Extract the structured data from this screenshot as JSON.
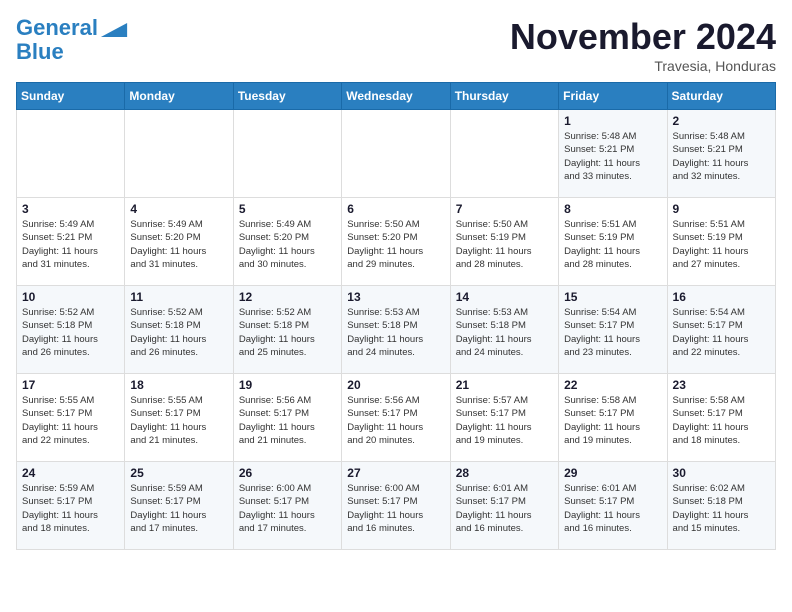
{
  "header": {
    "logo_line1": "General",
    "logo_line2": "Blue",
    "month": "November 2024",
    "location": "Travesia, Honduras"
  },
  "weekdays": [
    "Sunday",
    "Monday",
    "Tuesday",
    "Wednesday",
    "Thursday",
    "Friday",
    "Saturday"
  ],
  "weeks": [
    [
      {
        "day": "",
        "info": ""
      },
      {
        "day": "",
        "info": ""
      },
      {
        "day": "",
        "info": ""
      },
      {
        "day": "",
        "info": ""
      },
      {
        "day": "",
        "info": ""
      },
      {
        "day": "1",
        "info": "Sunrise: 5:48 AM\nSunset: 5:21 PM\nDaylight: 11 hours\nand 33 minutes."
      },
      {
        "day": "2",
        "info": "Sunrise: 5:48 AM\nSunset: 5:21 PM\nDaylight: 11 hours\nand 32 minutes."
      }
    ],
    [
      {
        "day": "3",
        "info": "Sunrise: 5:49 AM\nSunset: 5:21 PM\nDaylight: 11 hours\nand 31 minutes."
      },
      {
        "day": "4",
        "info": "Sunrise: 5:49 AM\nSunset: 5:20 PM\nDaylight: 11 hours\nand 31 minutes."
      },
      {
        "day": "5",
        "info": "Sunrise: 5:49 AM\nSunset: 5:20 PM\nDaylight: 11 hours\nand 30 minutes."
      },
      {
        "day": "6",
        "info": "Sunrise: 5:50 AM\nSunset: 5:20 PM\nDaylight: 11 hours\nand 29 minutes."
      },
      {
        "day": "7",
        "info": "Sunrise: 5:50 AM\nSunset: 5:19 PM\nDaylight: 11 hours\nand 28 minutes."
      },
      {
        "day": "8",
        "info": "Sunrise: 5:51 AM\nSunset: 5:19 PM\nDaylight: 11 hours\nand 28 minutes."
      },
      {
        "day": "9",
        "info": "Sunrise: 5:51 AM\nSunset: 5:19 PM\nDaylight: 11 hours\nand 27 minutes."
      }
    ],
    [
      {
        "day": "10",
        "info": "Sunrise: 5:52 AM\nSunset: 5:18 PM\nDaylight: 11 hours\nand 26 minutes."
      },
      {
        "day": "11",
        "info": "Sunrise: 5:52 AM\nSunset: 5:18 PM\nDaylight: 11 hours\nand 26 minutes."
      },
      {
        "day": "12",
        "info": "Sunrise: 5:52 AM\nSunset: 5:18 PM\nDaylight: 11 hours\nand 25 minutes."
      },
      {
        "day": "13",
        "info": "Sunrise: 5:53 AM\nSunset: 5:18 PM\nDaylight: 11 hours\nand 24 minutes."
      },
      {
        "day": "14",
        "info": "Sunrise: 5:53 AM\nSunset: 5:18 PM\nDaylight: 11 hours\nand 24 minutes."
      },
      {
        "day": "15",
        "info": "Sunrise: 5:54 AM\nSunset: 5:17 PM\nDaylight: 11 hours\nand 23 minutes."
      },
      {
        "day": "16",
        "info": "Sunrise: 5:54 AM\nSunset: 5:17 PM\nDaylight: 11 hours\nand 22 minutes."
      }
    ],
    [
      {
        "day": "17",
        "info": "Sunrise: 5:55 AM\nSunset: 5:17 PM\nDaylight: 11 hours\nand 22 minutes."
      },
      {
        "day": "18",
        "info": "Sunrise: 5:55 AM\nSunset: 5:17 PM\nDaylight: 11 hours\nand 21 minutes."
      },
      {
        "day": "19",
        "info": "Sunrise: 5:56 AM\nSunset: 5:17 PM\nDaylight: 11 hours\nand 21 minutes."
      },
      {
        "day": "20",
        "info": "Sunrise: 5:56 AM\nSunset: 5:17 PM\nDaylight: 11 hours\nand 20 minutes."
      },
      {
        "day": "21",
        "info": "Sunrise: 5:57 AM\nSunset: 5:17 PM\nDaylight: 11 hours\nand 19 minutes."
      },
      {
        "day": "22",
        "info": "Sunrise: 5:58 AM\nSunset: 5:17 PM\nDaylight: 11 hours\nand 19 minutes."
      },
      {
        "day": "23",
        "info": "Sunrise: 5:58 AM\nSunset: 5:17 PM\nDaylight: 11 hours\nand 18 minutes."
      }
    ],
    [
      {
        "day": "24",
        "info": "Sunrise: 5:59 AM\nSunset: 5:17 PM\nDaylight: 11 hours\nand 18 minutes."
      },
      {
        "day": "25",
        "info": "Sunrise: 5:59 AM\nSunset: 5:17 PM\nDaylight: 11 hours\nand 17 minutes."
      },
      {
        "day": "26",
        "info": "Sunrise: 6:00 AM\nSunset: 5:17 PM\nDaylight: 11 hours\nand 17 minutes."
      },
      {
        "day": "27",
        "info": "Sunrise: 6:00 AM\nSunset: 5:17 PM\nDaylight: 11 hours\nand 16 minutes."
      },
      {
        "day": "28",
        "info": "Sunrise: 6:01 AM\nSunset: 5:17 PM\nDaylight: 11 hours\nand 16 minutes."
      },
      {
        "day": "29",
        "info": "Sunrise: 6:01 AM\nSunset: 5:17 PM\nDaylight: 11 hours\nand 16 minutes."
      },
      {
        "day": "30",
        "info": "Sunrise: 6:02 AM\nSunset: 5:18 PM\nDaylight: 11 hours\nand 15 minutes."
      }
    ]
  ]
}
